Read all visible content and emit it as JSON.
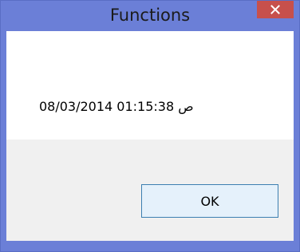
{
  "window": {
    "title": "Functions",
    "close_icon": "close-icon"
  },
  "content": {
    "message": "08/03/2014 01:15:38 ص"
  },
  "footer": {
    "ok_label": "OK"
  },
  "colors": {
    "frame": "#6b7fd7",
    "close_button": "#c7504c",
    "content_background": "#ffffff",
    "footer_background": "#f0f0f0",
    "ok_button_background": "#e5f1fb",
    "ok_button_border": "#3c7fb1"
  }
}
